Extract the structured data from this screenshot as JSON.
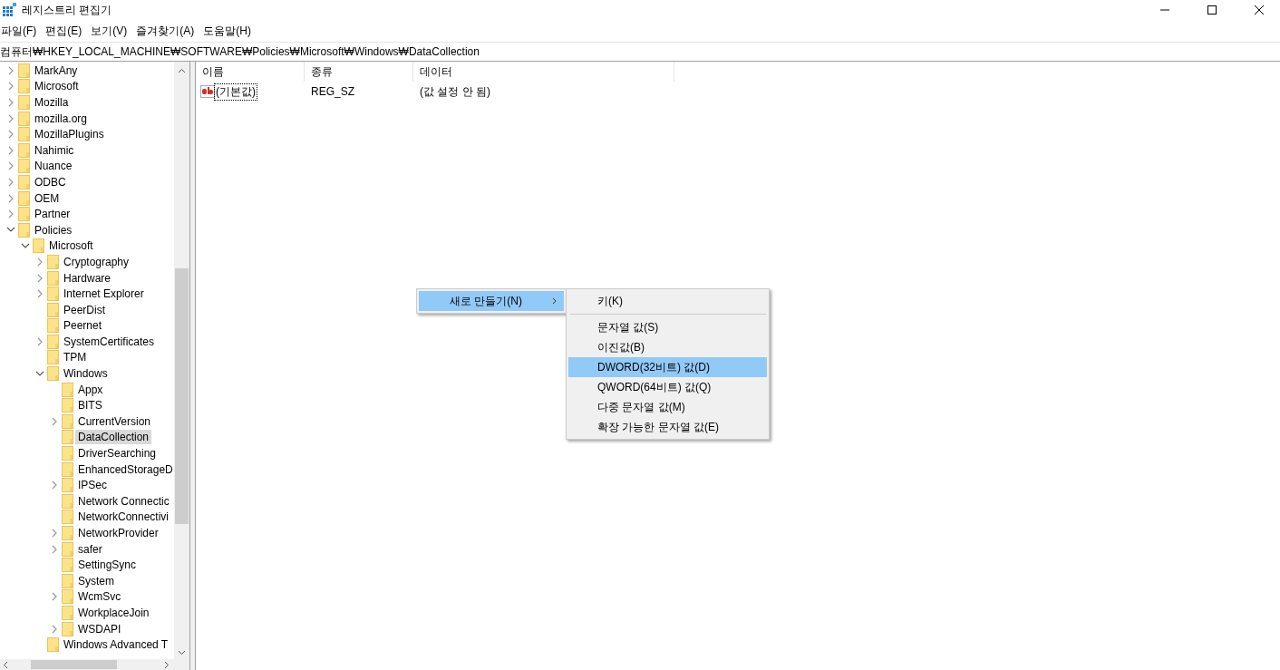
{
  "window": {
    "title": "레지스트리 편집기"
  },
  "menu_bar": [
    "파일(F)",
    "편집(E)",
    "보기(V)",
    "즐겨찾기(A)",
    "도움말(H)"
  ],
  "address_bar": {
    "value": "컴퓨터₩HKEY_LOCAL_MACHINE₩SOFTWARE₩Policies₩Microsoft₩Windows₩DataCollection"
  },
  "tree": {
    "items": [
      {
        "label": "MarkAny",
        "expandable": true,
        "expanded": false,
        "selected": false
      },
      {
        "label": "Microsoft",
        "expandable": true,
        "expanded": false,
        "selected": false
      },
      {
        "label": "Mozilla",
        "expandable": true,
        "expanded": false,
        "selected": false
      },
      {
        "label": "mozilla.org",
        "expandable": true,
        "expanded": false,
        "selected": false
      },
      {
        "label": "MozillaPlugins",
        "expandable": true,
        "expanded": false,
        "selected": false
      },
      {
        "label": "Nahimic",
        "expandable": true,
        "expanded": false,
        "selected": false
      },
      {
        "label": "Nuance",
        "expandable": true,
        "expanded": false,
        "selected": false
      },
      {
        "label": "ODBC",
        "expandable": true,
        "expanded": false,
        "selected": false
      },
      {
        "label": "OEM",
        "expandable": true,
        "expanded": false,
        "selected": false
      },
      {
        "label": "Partner",
        "expandable": true,
        "expanded": false,
        "selected": false
      },
      {
        "label": "Policies",
        "expandable": true,
        "expanded": true,
        "selected": false,
        "children": [
          {
            "label": "Microsoft",
            "expandable": true,
            "expanded": true,
            "selected": false,
            "children": [
              {
                "label": "Cryptography",
                "expandable": true,
                "expanded": false,
                "selected": false
              },
              {
                "label": "Hardware",
                "expandable": true,
                "expanded": false,
                "selected": false
              },
              {
                "label": "Internet Explorer",
                "expandable": true,
                "expanded": false,
                "selected": false
              },
              {
                "label": "PeerDist",
                "expandable": false,
                "selected": false
              },
              {
                "label": "Peernet",
                "expandable": false,
                "selected": false
              },
              {
                "label": "SystemCertificates",
                "expandable": true,
                "expanded": false,
                "selected": false
              },
              {
                "label": "TPM",
                "expandable": false,
                "selected": false
              },
              {
                "label": "Windows",
                "expandable": true,
                "expanded": true,
                "selected": false,
                "children": [
                  {
                    "label": "Appx",
                    "expandable": false,
                    "selected": false
                  },
                  {
                    "label": "BITS",
                    "expandable": false,
                    "selected": false
                  },
                  {
                    "label": "CurrentVersion",
                    "expandable": true,
                    "expanded": false,
                    "selected": false
                  },
                  {
                    "label": "DataCollection",
                    "expandable": false,
                    "selected": true
                  },
                  {
                    "label": "DriverSearching",
                    "expandable": false,
                    "selected": false
                  },
                  {
                    "label": "EnhancedStorageD",
                    "expandable": false,
                    "selected": false
                  },
                  {
                    "label": "IPSec",
                    "expandable": true,
                    "expanded": false,
                    "selected": false
                  },
                  {
                    "label": "Network Connectic",
                    "expandable": false,
                    "selected": false
                  },
                  {
                    "label": "NetworkConnectivi",
                    "expandable": false,
                    "selected": false
                  },
                  {
                    "label": "NetworkProvider",
                    "expandable": true,
                    "expanded": false,
                    "selected": false
                  },
                  {
                    "label": "safer",
                    "expandable": true,
                    "expanded": false,
                    "selected": false
                  },
                  {
                    "label": "SettingSync",
                    "expandable": false,
                    "selected": false
                  },
                  {
                    "label": "System",
                    "expandable": false,
                    "selected": false
                  },
                  {
                    "label": "WcmSvc",
                    "expandable": true,
                    "expanded": false,
                    "selected": false
                  },
                  {
                    "label": "WorkplaceJoin",
                    "expandable": false,
                    "selected": false
                  },
                  {
                    "label": "WSDAPI",
                    "expandable": true,
                    "expanded": false,
                    "selected": false
                  }
                ]
              },
              {
                "label": "Windows Advanced T",
                "expandable": false,
                "selected": false
              }
            ]
          }
        ]
      }
    ]
  },
  "values_table": {
    "columns": [
      "이름",
      "종류",
      "데이터"
    ],
    "rows": [
      {
        "kind": "string",
        "focused": true,
        "cells": [
          "(기본값)",
          "REG_SZ",
          "(값 설정 안 됨)"
        ]
      }
    ]
  },
  "context_menu": {
    "items": [
      {
        "label": "새로 만들기(N)",
        "selected": true,
        "has_submenu": true
      }
    ]
  },
  "submenu": {
    "items": [
      {
        "label": "키(K)",
        "selected": false,
        "separator_after": true
      },
      {
        "label": "문자열 값(S)",
        "selected": false,
        "separator_after": false
      },
      {
        "label": "이진값(B)",
        "selected": false,
        "separator_after": false
      },
      {
        "label": "DWORD(32비트) 값(D)",
        "selected": true,
        "separator_after": false
      },
      {
        "label": "QWORD(64비트) 값(Q)",
        "selected": false,
        "separator_after": false
      },
      {
        "label": "다중 문자열 값(M)",
        "selected": false,
        "separator_after": false
      },
      {
        "label": "확장 가능한 문자열 값(E)",
        "selected": false,
        "separator_after": false
      }
    ]
  }
}
